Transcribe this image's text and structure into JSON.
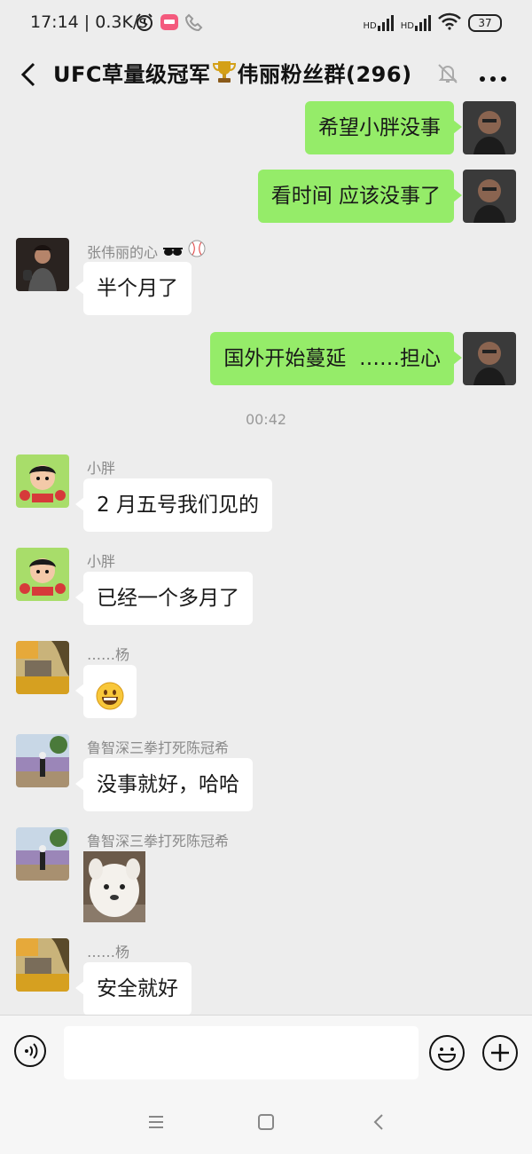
{
  "status_bar": {
    "time": "17:14 | 0.3K/s",
    "battery": "37",
    "hd1": "HD",
    "hd2": "HD",
    "icons": [
      "alarm-icon",
      "app-notification-icon",
      "phone-call-icon",
      "signal-icon",
      "wifi-icon",
      "battery-icon"
    ]
  },
  "header": {
    "title_prefix": "UFC草量级冠军",
    "title_suffix": "伟丽粉丝群(296)",
    "icons": [
      "back-icon",
      "trophy-icon",
      "mute-icon",
      "more-icon"
    ]
  },
  "messages": [
    {
      "type": "text",
      "direction": "out",
      "text": "希望小胖没事"
    },
    {
      "type": "text",
      "direction": "out",
      "text": "看时间 应该没事了"
    },
    {
      "type": "text",
      "direction": "in",
      "sender": "张伟丽的心",
      "text": "半个月了"
    },
    {
      "type": "text",
      "direction": "out",
      "text": "国外开始蔓延  ……担心"
    },
    {
      "type": "time",
      "text": "00:42"
    },
    {
      "type": "text",
      "direction": "in",
      "sender": "小胖",
      "text": "2 月五号我们见的"
    },
    {
      "type": "text",
      "direction": "in",
      "sender": "小胖",
      "text": "已经一个多月了"
    },
    {
      "type": "emoji",
      "direction": "in",
      "sender": "……杨",
      "emoji": "grinning-face"
    },
    {
      "type": "text",
      "direction": "in",
      "sender": "鲁智深三拳打死陈冠希",
      "text": "没事就好，哈哈"
    },
    {
      "type": "sticker",
      "direction": "in",
      "sender": "鲁智深三拳打死陈冠希",
      "sticker": "white-dog-sticker"
    },
    {
      "type": "text",
      "direction": "in",
      "sender": "……杨",
      "text": "安全就好"
    }
  ],
  "input_bar": {
    "placeholder": "",
    "icons": [
      "voice-icon",
      "emoji-icon",
      "plus-icon"
    ]
  },
  "nav_bar": {
    "icons": [
      "menu-icon",
      "home-icon",
      "back-nav-icon"
    ]
  },
  "colors": {
    "background": "#ededed",
    "outgoing_bubble": "#95ec69",
    "incoming_bubble": "#ffffff",
    "sender_name": "#8a8a8a"
  }
}
